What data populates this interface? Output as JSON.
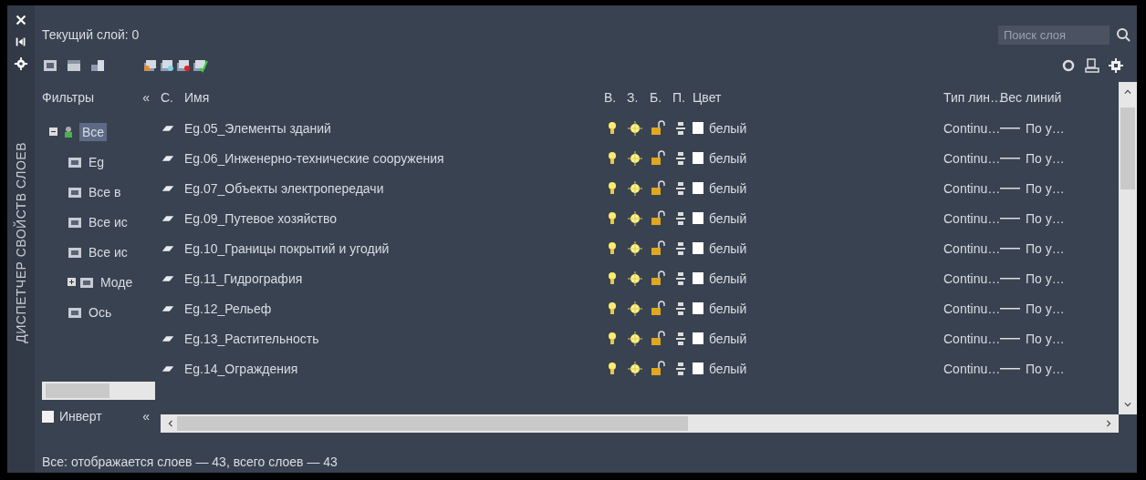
{
  "window": {
    "current_layer": "Текущий слой: 0",
    "side_title": "ДИСПЕТЧЕР СВОЙСТВ СЛОЕВ"
  },
  "search": {
    "placeholder": "Поиск слоя"
  },
  "filters": {
    "title": "Фильтры",
    "collapse": "«",
    "tree": [
      {
        "label": "Все",
        "selected": true,
        "expanded": true,
        "children": [
          {
            "label": "Eg",
            "selected": false
          },
          {
            "label": "Все в",
            "selected": false
          },
          {
            "label": "Все ис",
            "selected": false
          },
          {
            "label": "Все ис",
            "selected": false
          },
          {
            "label": "Моде",
            "selected": false,
            "expanded": false
          },
          {
            "label": "Ось",
            "selected": false
          }
        ]
      }
    ]
  },
  "invert": {
    "label": "Инверт",
    "checked": false,
    "collapse": "«"
  },
  "columns": [
    "С.",
    "Имя",
    "В.",
    "З.",
    "Б.",
    "П.",
    "Цвет",
    "Тип лин…",
    "Вес линий"
  ],
  "rows": [
    {
      "name": "Eg.05_Элементы зданий",
      "on": true,
      "frozen": false,
      "locked": false,
      "color_name": "белый",
      "color": "#ffffff",
      "linetype": "Continu…",
      "lineweight": "По у…"
    },
    {
      "name": "Eg.06_Инженерно-технические сооружения",
      "on": true,
      "frozen": false,
      "locked": false,
      "color_name": "белый",
      "color": "#ffffff",
      "linetype": "Continu…",
      "lineweight": "По у…"
    },
    {
      "name": "Eg.07_Объекты электропередачи",
      "on": true,
      "frozen": false,
      "locked": false,
      "color_name": "белый",
      "color": "#ffffff",
      "linetype": "Continu…",
      "lineweight": "По у…"
    },
    {
      "name": "Eg.09_Путевое хозяйство",
      "on": true,
      "frozen": false,
      "locked": false,
      "color_name": "белый",
      "color": "#ffffff",
      "linetype": "Continu…",
      "lineweight": "По у…"
    },
    {
      "name": "Eg.10_Границы покрытий и угодий",
      "on": true,
      "frozen": false,
      "locked": false,
      "color_name": "белый",
      "color": "#ffffff",
      "linetype": "Continu…",
      "lineweight": "По у…"
    },
    {
      "name": "Eg.11_Гидрография",
      "on": true,
      "frozen": false,
      "locked": false,
      "color_name": "белый",
      "color": "#ffffff",
      "linetype": "Continu…",
      "lineweight": "По у…"
    },
    {
      "name": "Eg.12_Рельеф",
      "on": true,
      "frozen": false,
      "locked": false,
      "color_name": "белый",
      "color": "#ffffff",
      "linetype": "Continu…",
      "lineweight": "По у…"
    },
    {
      "name": "Eg.13_Растительность",
      "on": true,
      "frozen": false,
      "locked": false,
      "color_name": "белый",
      "color": "#ffffff",
      "linetype": "Continu…",
      "lineweight": "По у…"
    },
    {
      "name": "Eg.14_Ограждения",
      "on": true,
      "frozen": false,
      "locked": false,
      "color_name": "белый",
      "color": "#ffffff",
      "linetype": "Continu…",
      "lineweight": "По у…"
    }
  ],
  "status_bar": "Все: отображается слоев — 43, всего слоев — 43"
}
